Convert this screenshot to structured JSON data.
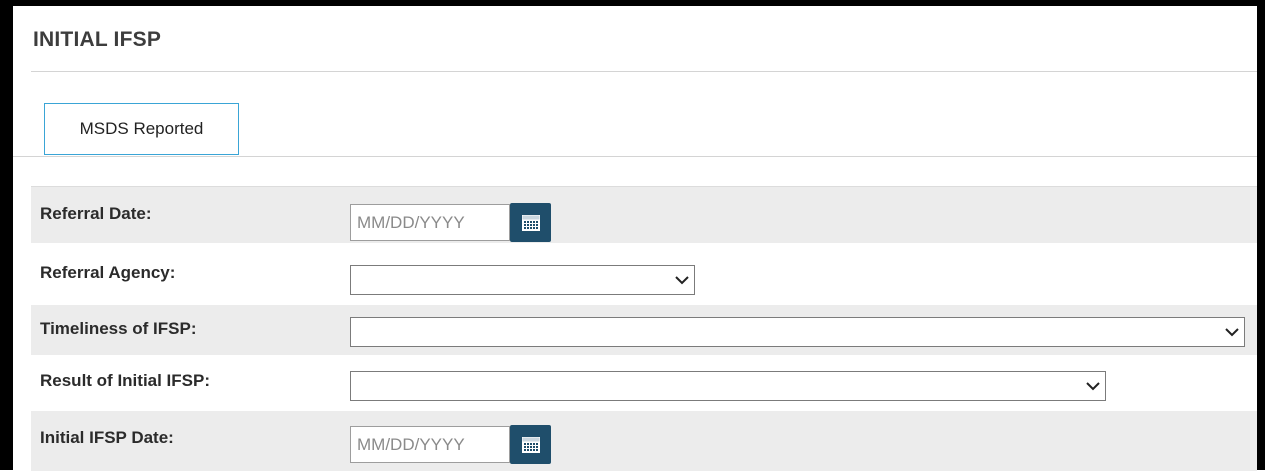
{
  "page": {
    "title": "INITIAL IFSP"
  },
  "tabs": [
    {
      "label": "MSDS Reported",
      "active": true
    }
  ],
  "form": {
    "referral_date": {
      "label": "Referral Date:",
      "value": "",
      "placeholder": "MM/DD/YYYY",
      "icon": "calendar-icon"
    },
    "referral_agency": {
      "label": "Referral Agency:",
      "value": "",
      "icon": "chevron-down-icon"
    },
    "timeliness": {
      "label": "Timeliness of IFSP:",
      "value": "",
      "icon": "chevron-down-icon"
    },
    "result": {
      "label": "Result of Initial IFSP:",
      "value": "",
      "icon": "chevron-down-icon"
    },
    "initial_date": {
      "label": "Initial IFSP Date:",
      "value": "",
      "placeholder": "MM/DD/YYYY",
      "icon": "calendar-icon"
    }
  },
  "colors": {
    "tab_border": "#3aa5d6",
    "calendar_button": "#1f4e6b",
    "row_shade": "#ececec",
    "frame": "#000000"
  }
}
